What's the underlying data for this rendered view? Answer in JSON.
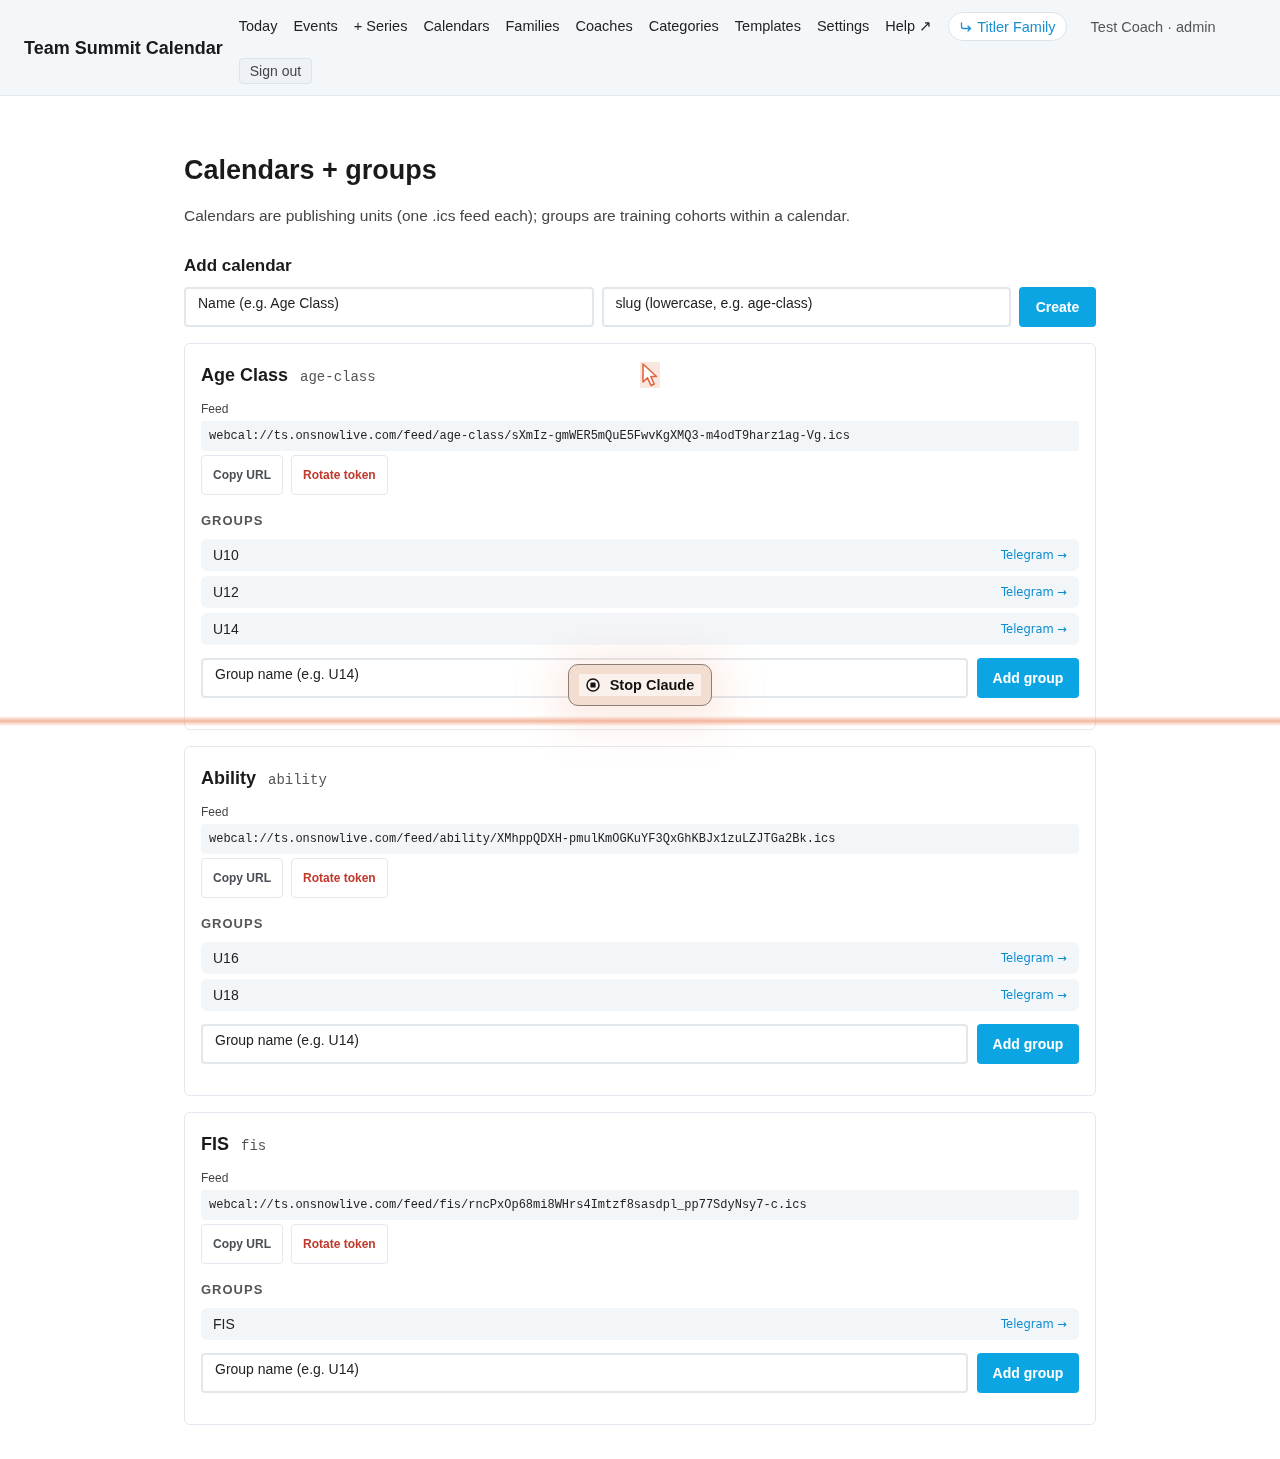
{
  "header": {
    "brand": "Team Summit Calendar",
    "nav": [
      "Today",
      "Events",
      "+ Series",
      "Calendars",
      "Families",
      "Coaches",
      "Categories",
      "Templates",
      "Settings",
      "Help ↗"
    ],
    "family_switch": "Titler Family",
    "user": "Test Coach · admin",
    "sign_out": "Sign out"
  },
  "page": {
    "title": "Calendars + groups",
    "intro": "Calendars are publishing units (one .ics feed each); groups are training cohorts within a calendar."
  },
  "add_calendar": {
    "heading": "Add calendar",
    "name_field": {
      "placeholder": "Name (e.g. Age Class)"
    },
    "slug_field": {
      "placeholder": "slug (lowercase, e.g. age-class)"
    },
    "button": "Create"
  },
  "calendars": [
    {
      "name": "Age Class",
      "slug": "age-class",
      "feed_label": "Feed",
      "feed_url": "webcal://ts.onsnowlive.com/feed/age-class/sXmIz-gmWER5mQuE5FwvKgXMQ3-m4odT9harz1ag-Vg.ics",
      "copy_button": "Copy URL",
      "rotate_button": "Rotate token",
      "groups_heading": "GROUPS",
      "groups": [
        {
          "name": "U10",
          "link": "Telegram →"
        },
        {
          "name": "U12",
          "link": "Telegram →"
        },
        {
          "name": "U14",
          "link": "Telegram →"
        }
      ],
      "group_field": {
        "placeholder": "Group name (e.g. U14)"
      },
      "add_button": "Add group"
    },
    {
      "name": "Ability",
      "slug": "ability",
      "feed_label": "Feed",
      "feed_url": "webcal://ts.onsnowlive.com/feed/ability/XMhppQDXH-pmulKmOGKuYF3QxGhKBJx1zuLZJTGa2Bk.ics",
      "copy_button": "Copy URL",
      "rotate_button": "Rotate token",
      "groups_heading": "GROUPS",
      "groups": [
        {
          "name": "U16",
          "link": "Telegram →"
        },
        {
          "name": "U18",
          "link": "Telegram →"
        }
      ],
      "group_field": {
        "placeholder": "Group name (e.g. U14)"
      },
      "add_button": "Add group"
    },
    {
      "name": "FIS",
      "slug": "fis",
      "feed_label": "Feed",
      "feed_url": "webcal://ts.onsnowlive.com/feed/fis/rncPxOp68mi8WHrs4Imtzf8sasdpl_pp77SdyNsy7-c.ics",
      "copy_button": "Copy URL",
      "rotate_button": "Rotate token",
      "groups_heading": "GROUPS",
      "groups": [
        {
          "name": "FIS",
          "link": "Telegram →"
        }
      ],
      "group_field": {
        "placeholder": "Group name (e.g. U14)"
      },
      "add_button": "Add group"
    }
  ],
  "overlay": {
    "stop_button": "Stop Claude"
  }
}
